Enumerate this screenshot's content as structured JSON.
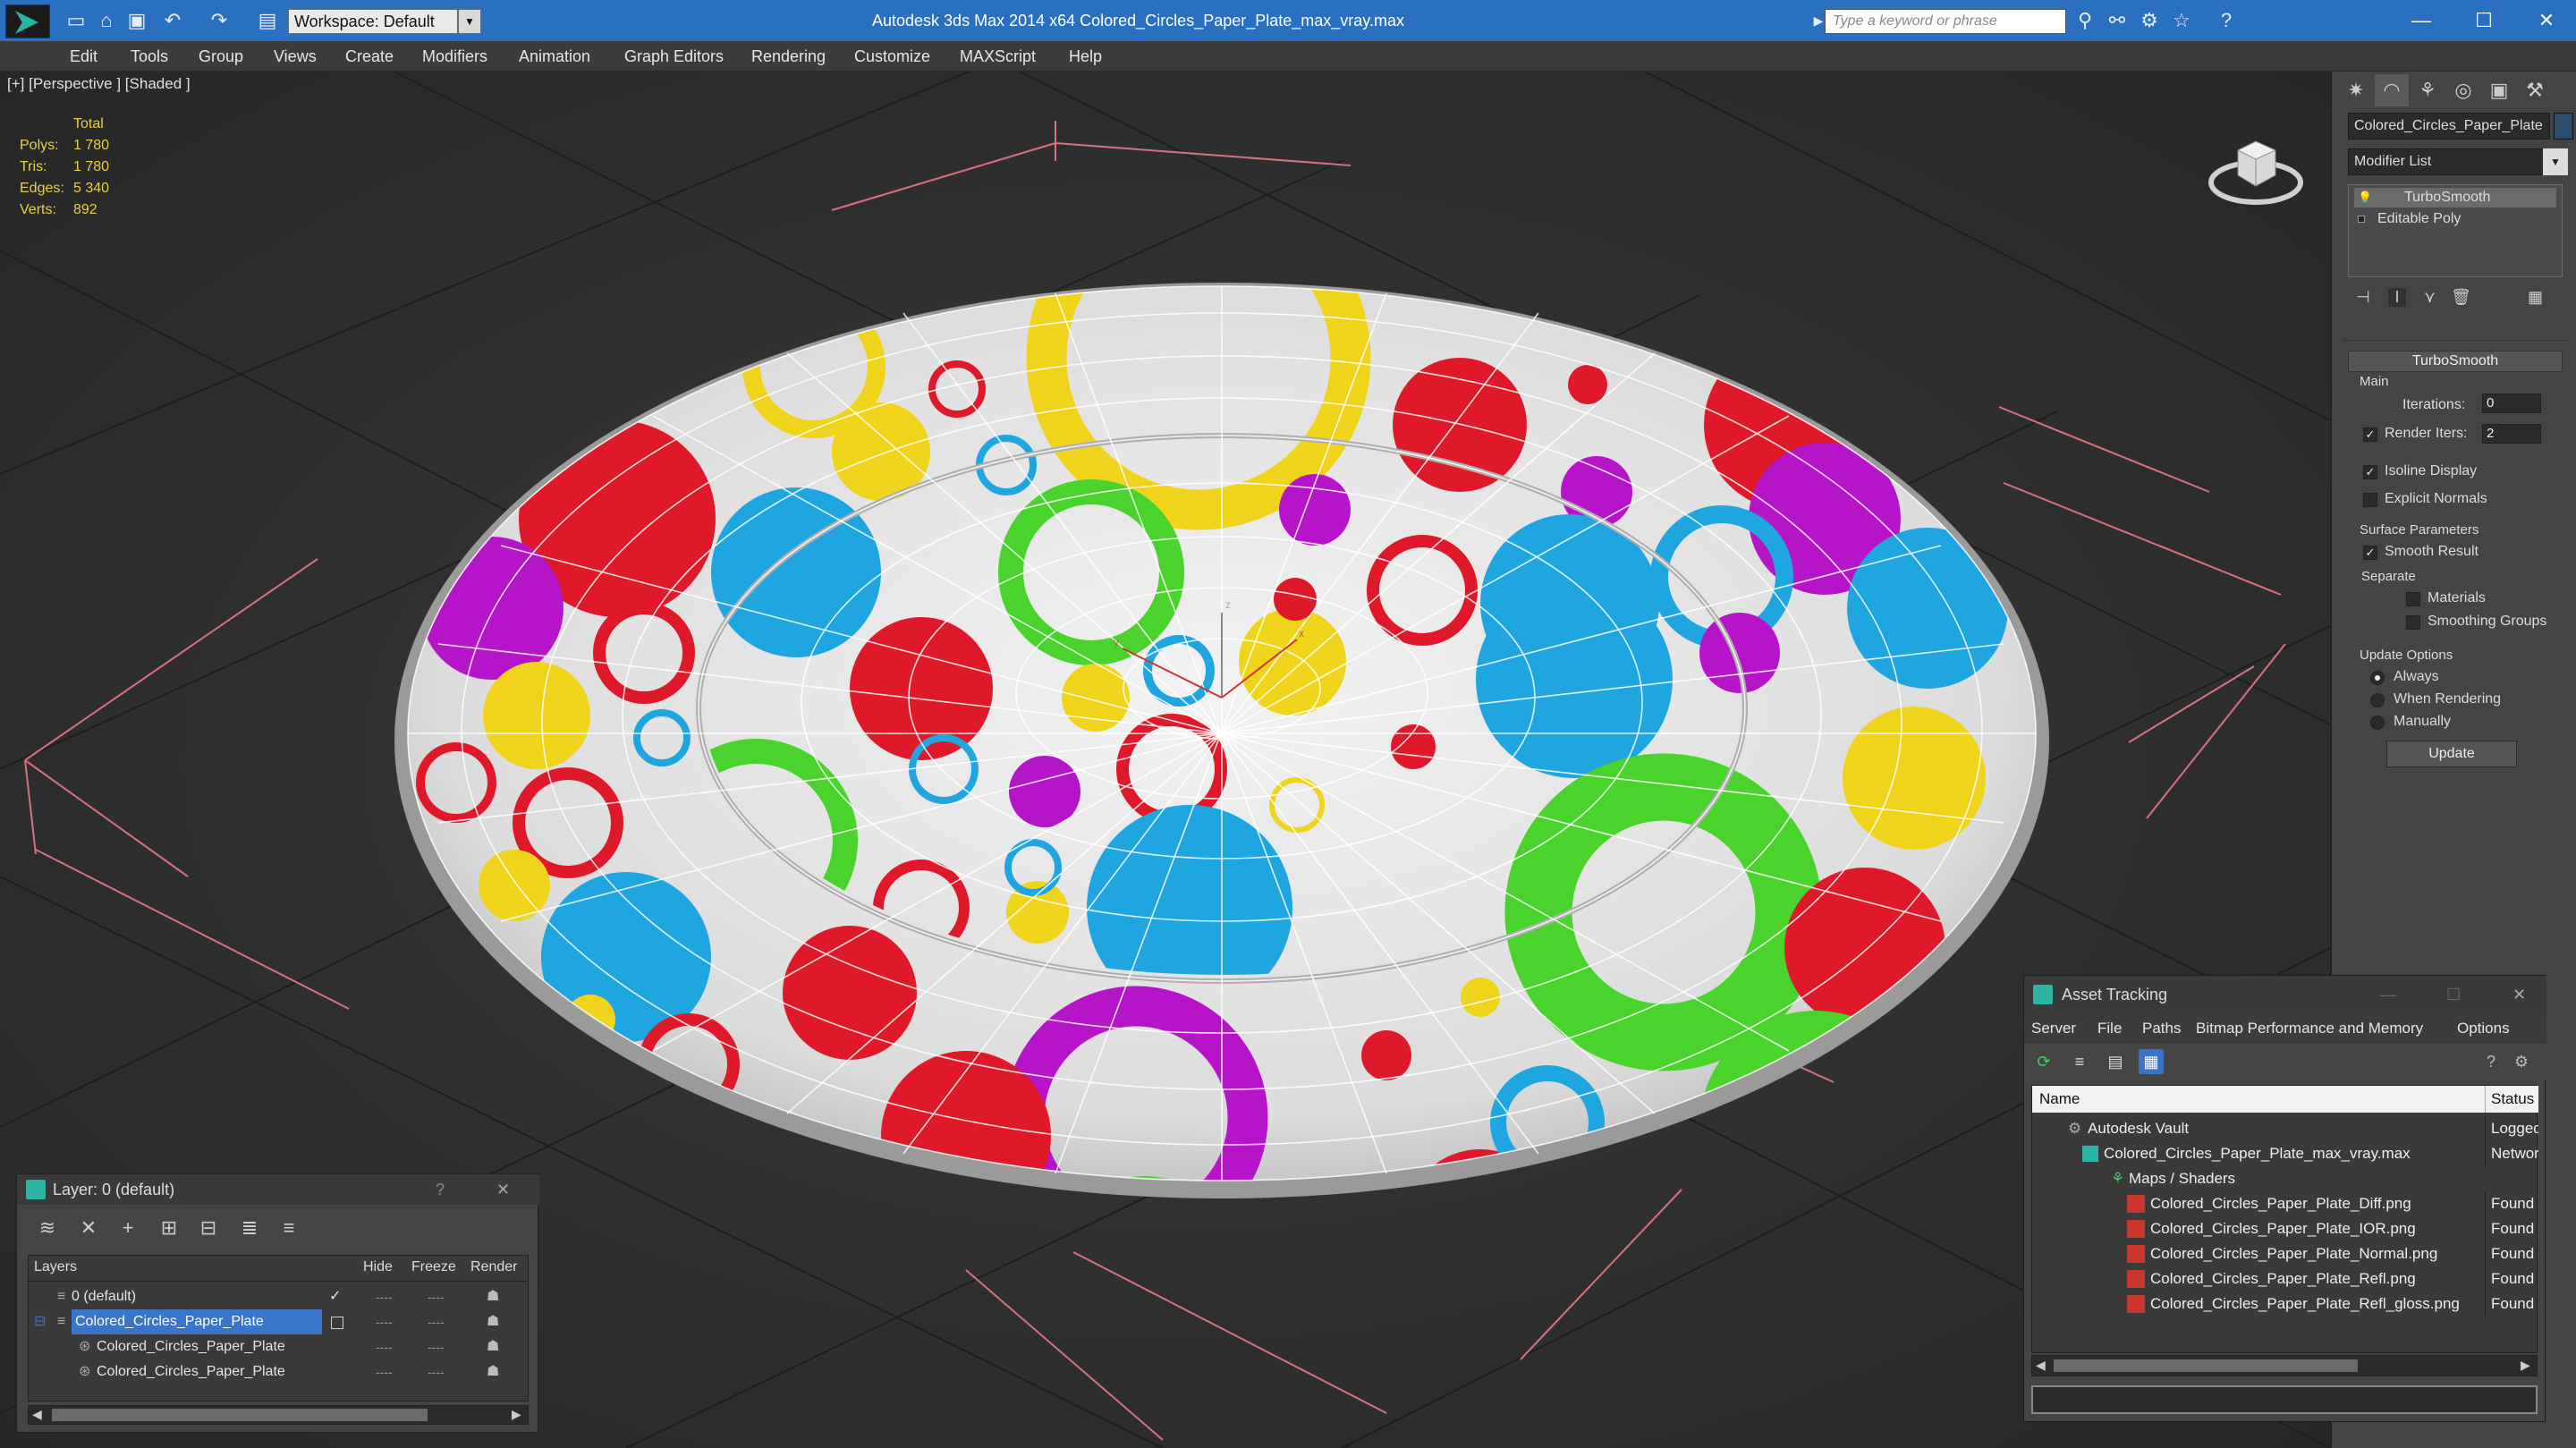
{
  "titlebar": {
    "workspace_label": "Workspace: Default",
    "app_title": "Autodesk 3ds Max  2014 x64      Colored_Circles_Paper_Plate_max_vray.max",
    "search_placeholder": "Type a keyword or phrase",
    "minimize": "—",
    "maximize": "☐",
    "close": "✕"
  },
  "menubar": {
    "items": [
      "Edit",
      "Tools",
      "Group",
      "Views",
      "Create",
      "Modifiers",
      "Animation",
      "Graph Editors",
      "Rendering",
      "Customize",
      "MAXScript",
      "Help"
    ]
  },
  "viewport": {
    "label": "[+] [Perspective ] [Shaded ]",
    "stats": {
      "total_label": "Total",
      "polys_label": "Polys:",
      "polys": "1 780",
      "tris_label": "Tris:",
      "tris": "1 780",
      "edges_label": "Edges:",
      "edges": "5 340",
      "verts_label": "Verts:",
      "verts": "892"
    },
    "axis_labels": {
      "x": "x",
      "y": "y",
      "z": "z"
    }
  },
  "command_panel": {
    "object_name": "Colored_Circles_Paper_Plate",
    "modifier_list": "Modifier List",
    "stack": [
      "TurboSmooth",
      "Editable Poly"
    ],
    "rollout": "TurboSmooth",
    "main_label": "Main",
    "iterations_label": "Iterations:",
    "iterations": "0",
    "render_iters_label": "Render Iters:",
    "render_iters": "2",
    "isoline_label": "Isoline Display",
    "explicit_normals_label": "Explicit Normals",
    "surface_params_label": "Surface Parameters",
    "smooth_result_label": "Smooth Result",
    "separate_label": "Separate",
    "materials_label": "Materials",
    "smoothing_groups_label": "Smoothing Groups",
    "update_options_label": "Update Options",
    "always_label": "Always",
    "when_rendering_label": "When Rendering",
    "manually_label": "Manually",
    "update_button": "Update",
    "render_iters_checked": true,
    "isoline_checked": true,
    "explicit_normals_checked": false,
    "smooth_result_checked": true,
    "materials_checked": false,
    "smoothing_groups_checked": false,
    "update_option_selected": "Always"
  },
  "layer_panel": {
    "title": "Layer: 0 (default)",
    "help": "?",
    "close": "✕",
    "columns": [
      "Layers",
      "Hide",
      "Freeze",
      "Render"
    ],
    "rows": [
      {
        "name": "0 (default)",
        "checked": "✓"
      },
      {
        "name": "Colored_Circles_Paper_Plate",
        "selected": true
      },
      {
        "name": "Colored_Circles_Paper_Plate"
      },
      {
        "name": "Colored_Circles_Paper_Plate"
      }
    ],
    "dash": "----"
  },
  "asset_panel": {
    "title": "Asset Tracking",
    "menu": [
      "Server",
      "File",
      "Paths",
      "Bitmap Performance and Memory",
      "Options"
    ],
    "columns": [
      "Name",
      "Status"
    ],
    "rows": [
      {
        "name": "Autodesk Vault",
        "status": "Logged"
      },
      {
        "name": "Colored_Circles_Paper_Plate_max_vray.max",
        "status": "Networ"
      },
      {
        "name": "Maps / Shaders",
        "status": ""
      },
      {
        "name": "Colored_Circles_Paper_Plate_Diff.png",
        "status": "Found"
      },
      {
        "name": "Colored_Circles_Paper_Plate_IOR.png",
        "status": "Found"
      },
      {
        "name": "Colored_Circles_Paper_Plate_Normal.png",
        "status": "Found"
      },
      {
        "name": "Colored_Circles_Paper_Plate_Refl.png",
        "status": "Found"
      },
      {
        "name": "Colored_Circles_Paper_Plate_Refl_gloss.png",
        "status": "Found"
      }
    ]
  },
  "colors": {
    "title_bar": "#2a6fc0",
    "stat_text": "#e8cf4a",
    "selection": "#3a74c9",
    "plate_red": "#e0192a",
    "plate_yellow": "#f0d41c",
    "plate_blue": "#1fa6e0",
    "plate_green": "#4ad32c",
    "plate_magenta": "#b514c9"
  }
}
